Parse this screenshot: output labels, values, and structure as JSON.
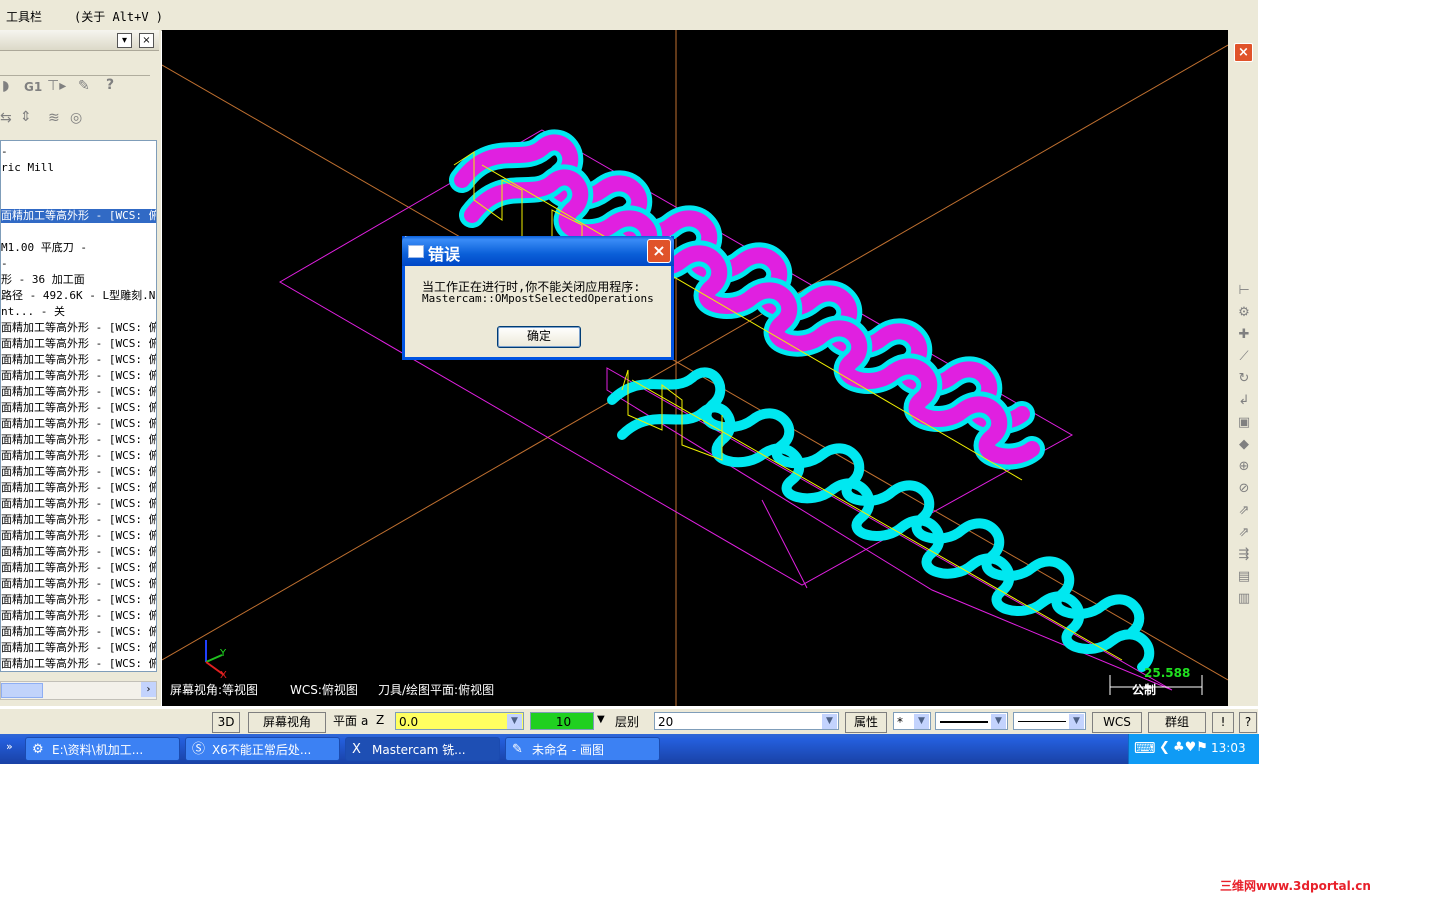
{
  "menubar": {
    "item1": "工具栏",
    "item2": "(关于 Alt+V )"
  },
  "ops_manager": {
    "toolbar_icons": [
      "path-icon",
      "g1-icon",
      "post-icon",
      "wand-icon",
      "help-icon",
      "sort-icon",
      "expand-icon",
      "lines-icon",
      "shapes-icon"
    ],
    "lines": [
      {
        "text": "-",
        "selected": false
      },
      {
        "text": "ric Mill",
        "selected": false
      },
      {
        "text": "",
        "selected": false
      },
      {
        "text": "",
        "selected": false
      },
      {
        "text": "面精加工等高外形 - [WCS: 俯",
        "selected": true
      },
      {
        "text": "",
        "selected": false
      },
      {
        "text": "M1.00 平底刀 -",
        "selected": false
      },
      {
        "text": "-",
        "selected": false
      },
      {
        "text": "形 - 36 加工面",
        "selected": false
      },
      {
        "text": "路径 - 492.6K - L型雕刻.NC",
        "selected": false
      },
      {
        "text": "nt... - 关",
        "selected": false
      },
      {
        "text": "面精加工等高外形 - [WCS: 俯",
        "selected": false
      },
      {
        "text": "面精加工等高外形 - [WCS: 俯",
        "selected": false
      },
      {
        "text": "面精加工等高外形 - [WCS: 俯",
        "selected": false
      },
      {
        "text": "面精加工等高外形 - [WCS: 俯",
        "selected": false
      },
      {
        "text": "面精加工等高外形 - [WCS: 俯",
        "selected": false
      },
      {
        "text": "面精加工等高外形 - [WCS: 俯",
        "selected": false
      },
      {
        "text": "面精加工等高外形 - [WCS: 俯",
        "selected": false
      },
      {
        "text": "面精加工等高外形 - [WCS: 俯",
        "selected": false
      },
      {
        "text": "面精加工等高外形 - [WCS: 俯",
        "selected": false
      },
      {
        "text": "面精加工等高外形 - [WCS: 俯",
        "selected": false
      },
      {
        "text": "面精加工等高外形 - [WCS: 俯",
        "selected": false
      },
      {
        "text": "面精加工等高外形 - [WCS: 俯",
        "selected": false
      },
      {
        "text": "面精加工等高外形 - [WCS: 俯",
        "selected": false
      },
      {
        "text": "面精加工等高外形 - [WCS: 俯",
        "selected": false
      },
      {
        "text": "面精加工等高外形 - [WCS: 俯",
        "selected": false
      },
      {
        "text": "面精加工等高外形 - [WCS: 俯",
        "selected": false
      },
      {
        "text": "面精加工等高外形 - [WCS: 俯",
        "selected": false
      },
      {
        "text": "面精加工等高外形 - [WCS: 俯",
        "selected": false
      },
      {
        "text": "面精加工等高外形 - [WCS: 俯",
        "selected": false
      },
      {
        "text": "面精加工等高外形 - [WCS: 俯",
        "selected": false
      },
      {
        "text": "面精加工等高外形 - [WCS: 俯",
        "selected": false
      },
      {
        "text": "面精加工等高外形 - [WCS: 俯",
        "selected": false
      }
    ]
  },
  "viewport": {
    "screen_view": "屏幕视角:等视图",
    "wcs_view": "WCS:俯视图",
    "tool_plane": "刀具/绘图平面:俯视图",
    "scale_value": "25.588",
    "scale_unit": "公制",
    "axis_y": "Y",
    "axis_x": "X",
    "colors": {
      "background": "#000000",
      "magenta": "#e020e0",
      "cyan": "#00e8f0",
      "yellow": "#f0f000",
      "orange": "#c07030"
    }
  },
  "dialog": {
    "title": "错误",
    "message_line1": "当工作正在进行时,你不能关闭应用程序:",
    "message_line2": "Mastercam::OMpostSelectedOperations",
    "ok_label": "确定"
  },
  "statusbar": {
    "btn_3d": "3D",
    "btn_screen_view": "屏幕视角",
    "btn_plane": "平面",
    "plane_suffix": "a",
    "z_label": "Z",
    "z_value": "0.0",
    "color_value": "10",
    "layer_label": "层别",
    "layer_value": "20",
    "attr_label": "属性",
    "point_style": "*",
    "wcs_label": "WCS",
    "group_label": "群组",
    "bang": "!",
    "help": "?"
  },
  "taskbar": {
    "tasks": [
      {
        "label": "E:\\资料\\机加工...",
        "icon": "folder-icon"
      },
      {
        "label": "X6不能正常后处...",
        "icon": "browser-icon"
      },
      {
        "label": "Mastercam 铣...",
        "icon": "mastercam-icon"
      },
      {
        "label": "未命名 - 画图",
        "icon": "paint-icon"
      }
    ],
    "clock": "13:03"
  },
  "watermark": "三维网www.3dportal.cn"
}
